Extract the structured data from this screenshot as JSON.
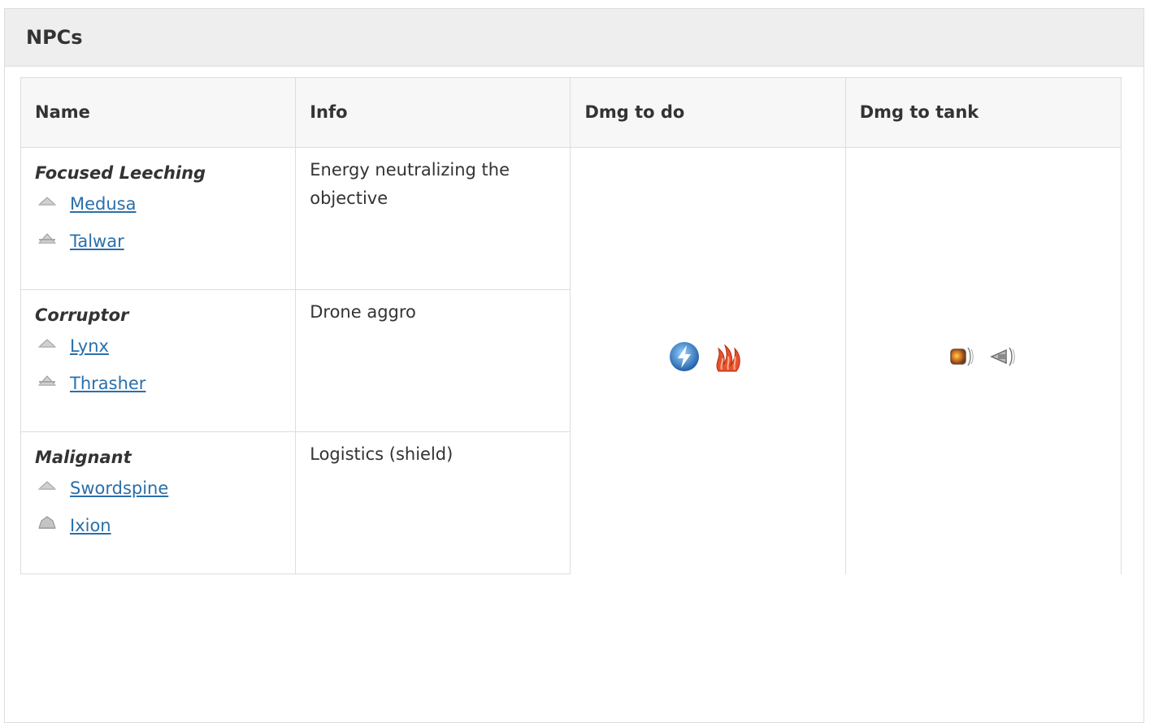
{
  "panel": {
    "title": "NPCs"
  },
  "table": {
    "headers": [
      "Name",
      "Info",
      "Dmg to do",
      "Dmg to tank"
    ],
    "groups": [
      {
        "title": "Focused Leeching",
        "info": "Energy neutralizing the objective",
        "ships": [
          {
            "name": "Medusa",
            "icon": "frigate-class-icon"
          },
          {
            "name": "Talwar",
            "icon": "destroyer-class-icon"
          }
        ]
      },
      {
        "title": "Corruptor",
        "info": "Drone aggro",
        "ships": [
          {
            "name": "Lynx",
            "icon": "frigate-class-icon"
          },
          {
            "name": "Thrasher",
            "icon": "destroyer-class-icon"
          }
        ]
      },
      {
        "title": "Malignant",
        "info": "Logistics (shield)",
        "ships": [
          {
            "name": "Swordspine",
            "icon": "frigate-class-icon"
          },
          {
            "name": "Ixion",
            "icon": "cruiser-class-icon"
          }
        ]
      }
    ],
    "dmg_to_do_icons": [
      "em-damage-icon",
      "thermal-damage-icon"
    ],
    "dmg_to_tank_icons": [
      "explosive-resist-icon",
      "kinetic-resist-icon"
    ]
  },
  "colors": {
    "link": "#2a6faa",
    "header_bg": "#eeeeee",
    "border": "#dddddd",
    "em": "#3a8fd8",
    "thermal": "#d8402a"
  }
}
